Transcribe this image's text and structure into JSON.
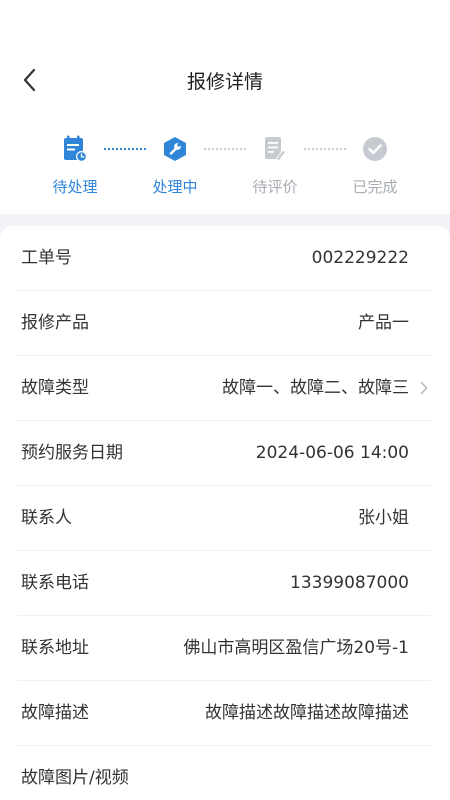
{
  "header": {
    "title": "报修详情",
    "back_icon": "chevron-left-icon"
  },
  "steps": [
    {
      "label": "待处理",
      "icon": "calendar-clock-icon",
      "state": "done"
    },
    {
      "label": "处理中",
      "icon": "wrench-icon",
      "state": "current"
    },
    {
      "label": "待评价",
      "icon": "document-edit-icon",
      "state": "pending"
    },
    {
      "label": "已完成",
      "icon": "check-circle-icon",
      "state": "pending"
    }
  ],
  "details": [
    {
      "key": "工单号",
      "value": "002229222"
    },
    {
      "key": "报修产品",
      "value": "产品一"
    },
    {
      "key": "故障类型",
      "value": "故障一、故障二、故障三",
      "has_chevron": true
    },
    {
      "key": "预约服务日期",
      "value": "2024-06-06 14:00"
    },
    {
      "key": "联系人",
      "value": "张小姐"
    },
    {
      "key": "联系电话",
      "value": "13399087000"
    },
    {
      "key": "联系地址",
      "value": "佛山市高明区盈信广场20号-1"
    },
    {
      "key": "故障描述",
      "value": "故障描述故障描述故障描述"
    },
    {
      "key": "故障图片/视频",
      "value": ""
    }
  ],
  "colors": {
    "accent": "#2f86d9",
    "inactive": "#c7cbd1",
    "divider": "#eeeff1",
    "gap_bg": "#f1f3f6"
  }
}
